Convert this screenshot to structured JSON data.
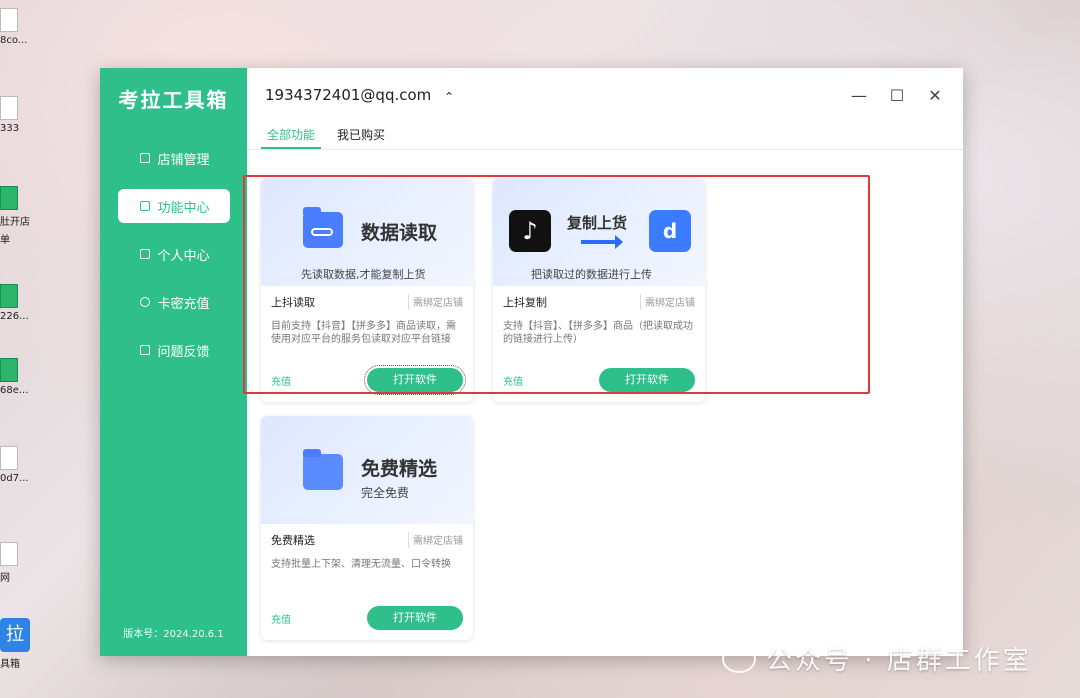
{
  "desktop": {
    "icons": [
      {
        "label": "8co...",
        "icon": "file-icon"
      },
      {
        "label": "333",
        "icon": "file-icon"
      },
      {
        "label": "肚开店",
        "icon": "excel-icon"
      },
      {
        "label": "单",
        "icon": "file-icon"
      },
      {
        "label": "226...",
        "icon": "app-icon"
      },
      {
        "label": "68e...",
        "icon": "app-icon"
      },
      {
        "label": "0d7...",
        "icon": "app-icon"
      },
      {
        "label": "网",
        "icon": "file-icon"
      },
      {
        "label": "具箱",
        "icon": "kaola-icon",
        "glyph": "拉"
      }
    ]
  },
  "sidebar": {
    "logo": "考拉工具箱",
    "items": [
      {
        "label": "店铺管理",
        "icon": "store-icon"
      },
      {
        "label": "功能中心",
        "icon": "grid-icon",
        "active": true
      },
      {
        "label": "个人中心",
        "icon": "id-card-icon"
      },
      {
        "label": "卡密充值",
        "icon": "user-icon"
      },
      {
        "label": "问题反馈",
        "icon": "feedback-icon"
      }
    ],
    "version": "版本号：2024.20.6.1"
  },
  "header": {
    "account": "1934372401@qq.com",
    "chevron": "^"
  },
  "window_controls": {
    "minimize": "—",
    "maximize": "☐",
    "close": "✕"
  },
  "tabs": [
    {
      "label": "全部功能",
      "active": true
    },
    {
      "label": "我已购买",
      "active": false
    }
  ],
  "cards": [
    {
      "banner_title": "数据读取",
      "banner_sub": "先读取数据,才能复制上货",
      "name": "上抖读取",
      "tag": "需绑定店铺",
      "desc": "目前支持【抖音】【拼多多】商品读取，需使用对应平台的服务包读取对应平台链接",
      "recharge": "充值",
      "open": "打开软件"
    },
    {
      "banner_title": "复制上货",
      "banner_sub": "把读取过的数据进行上传",
      "name": "上抖复制",
      "tag": "需绑定店铺",
      "desc": "支持【抖音】、【拼多多】商品（把读取成功的链接进行上传）",
      "recharge": "充值",
      "open": "打开软件"
    },
    {
      "banner_title": "免费精选",
      "banner_sub": "完全免费",
      "name": "免费精选",
      "tag": "需绑定店铺",
      "desc": "支持批量上下架、清理无流量、口令转换",
      "recharge": "充值",
      "open": "打开软件"
    }
  ],
  "watermark": "公众号 · 店群工作室",
  "colors": {
    "accent": "#2fbf8b",
    "highlight": "#d93b3b",
    "brand_blue": "#4a7dff"
  }
}
